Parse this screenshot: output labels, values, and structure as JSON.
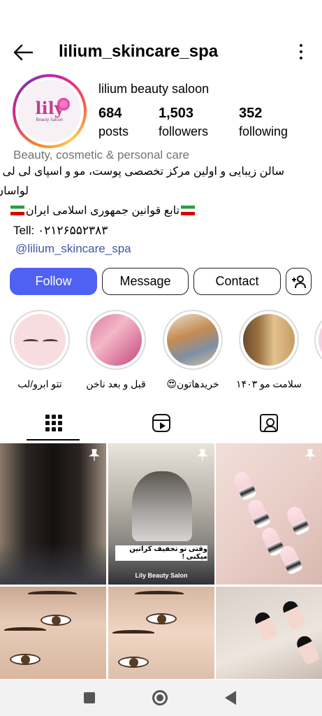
{
  "header": {
    "username": "lilium_skincare_spa"
  },
  "profile": {
    "avatar_text": "lily",
    "avatar_subtext": "Beauty Saloon",
    "display_name": "lilium beauty saloon",
    "stats": [
      {
        "value": "684",
        "label": "posts"
      },
      {
        "value": "1,503",
        "label": "followers"
      },
      {
        "value": "352",
        "label": "following"
      }
    ],
    "category": "Beauty, cosmetic & personal care",
    "bio_line1": "سالن زیبایی و اولین مرکز تخصصی پوست، مو و اسپای لی لی",
    "bio_line2": "لواسان",
    "bio_line3": "تابع قوانین جمهوری اسلامی ایران",
    "tel": "Tell: ۰۲۱۲۶۵۵۲۳۸۳",
    "link": "@lilium_skincare_spa"
  },
  "actions": {
    "follow": "Follow",
    "message": "Message",
    "contact": "Contact"
  },
  "highlights": [
    {
      "label": "تتو ابرو/لب"
    },
    {
      "label": "قبل و بعد ناخن"
    },
    {
      "label": "خریدهاتون😍"
    },
    {
      "label": "سلامت مو ۱۴۰۳"
    }
  ],
  "tabs": [
    "grid-icon",
    "reels-icon",
    "tagged-icon"
  ],
  "posts": {
    "p2_caption": "وقتی تو تخفیف کراتین میکنی !",
    "p2_brand": "Lily Beauty Salon"
  },
  "colors": {
    "follow_button": "#4f61f3",
    "link": "#3f56a8",
    "category": "#737373"
  }
}
